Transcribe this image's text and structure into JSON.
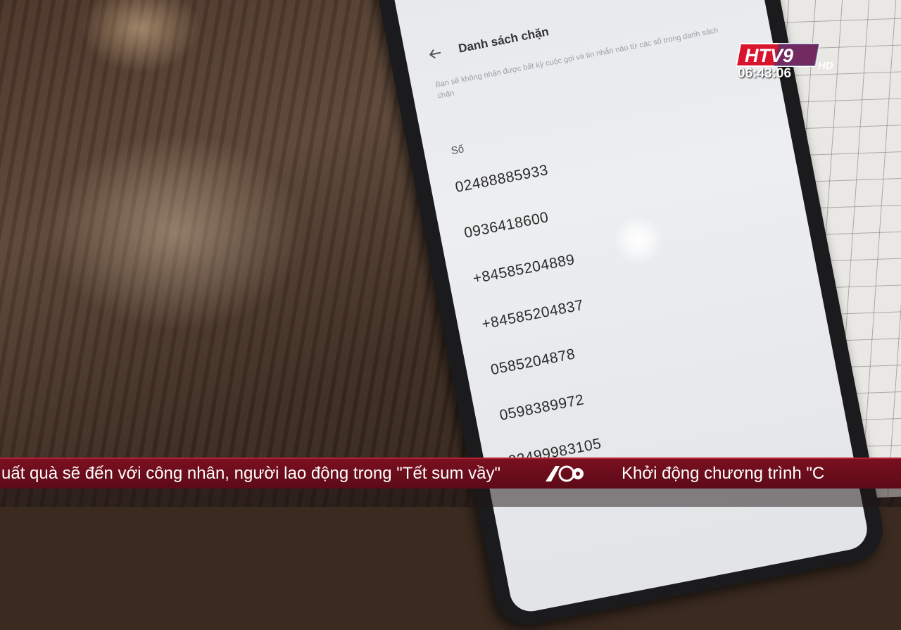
{
  "screen": {
    "title": "Danh sách chặn",
    "subtitle": "Bạn sẽ không nhận được bất kỳ cuộc gọi và tin nhắn nào từ các số trong danh sách chặn",
    "section_label": "Số",
    "numbers": [
      "02488885933",
      "0936418600",
      "+84585204889",
      "+84585204837",
      "0585204878",
      "0598389972",
      "02499983105"
    ]
  },
  "broadcast": {
    "channel_logo_text": "HTV9",
    "channel_hd": "HD",
    "clock": "06:43:06",
    "ticker_left": "uất quà sẽ đến với công nhân, người lao động trong \"Tết sum vầy\"",
    "ticker_right": "Khởi động chương trình \"C"
  },
  "colors": {
    "ticker_bg": "#6b0d1c",
    "logo_red": "#d9152d",
    "logo_blue": "#1c3e8c"
  }
}
